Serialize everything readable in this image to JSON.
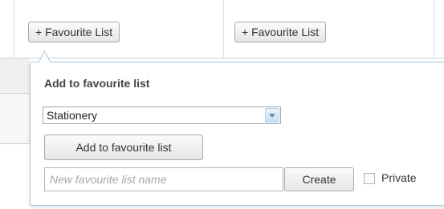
{
  "toolbar": {
    "favourite_list_button_1": "+ Favourite List",
    "favourite_list_button_2": "+ Favourite List"
  },
  "popup": {
    "title": "Add to favourite list",
    "list_select": {
      "selected": "Stationery"
    },
    "add_button_label": "Add to favourite list",
    "new_list_input": {
      "value": "",
      "placeholder": "New favourite list name"
    },
    "create_button_label": "Create",
    "private_checkbox": {
      "label": "Private",
      "checked": false
    }
  },
  "icons": {
    "select_arrow": "chevron-down-icon"
  },
  "colors": {
    "popup_border": "#a8c8de",
    "select_arrow_bg": "#cddff0"
  }
}
